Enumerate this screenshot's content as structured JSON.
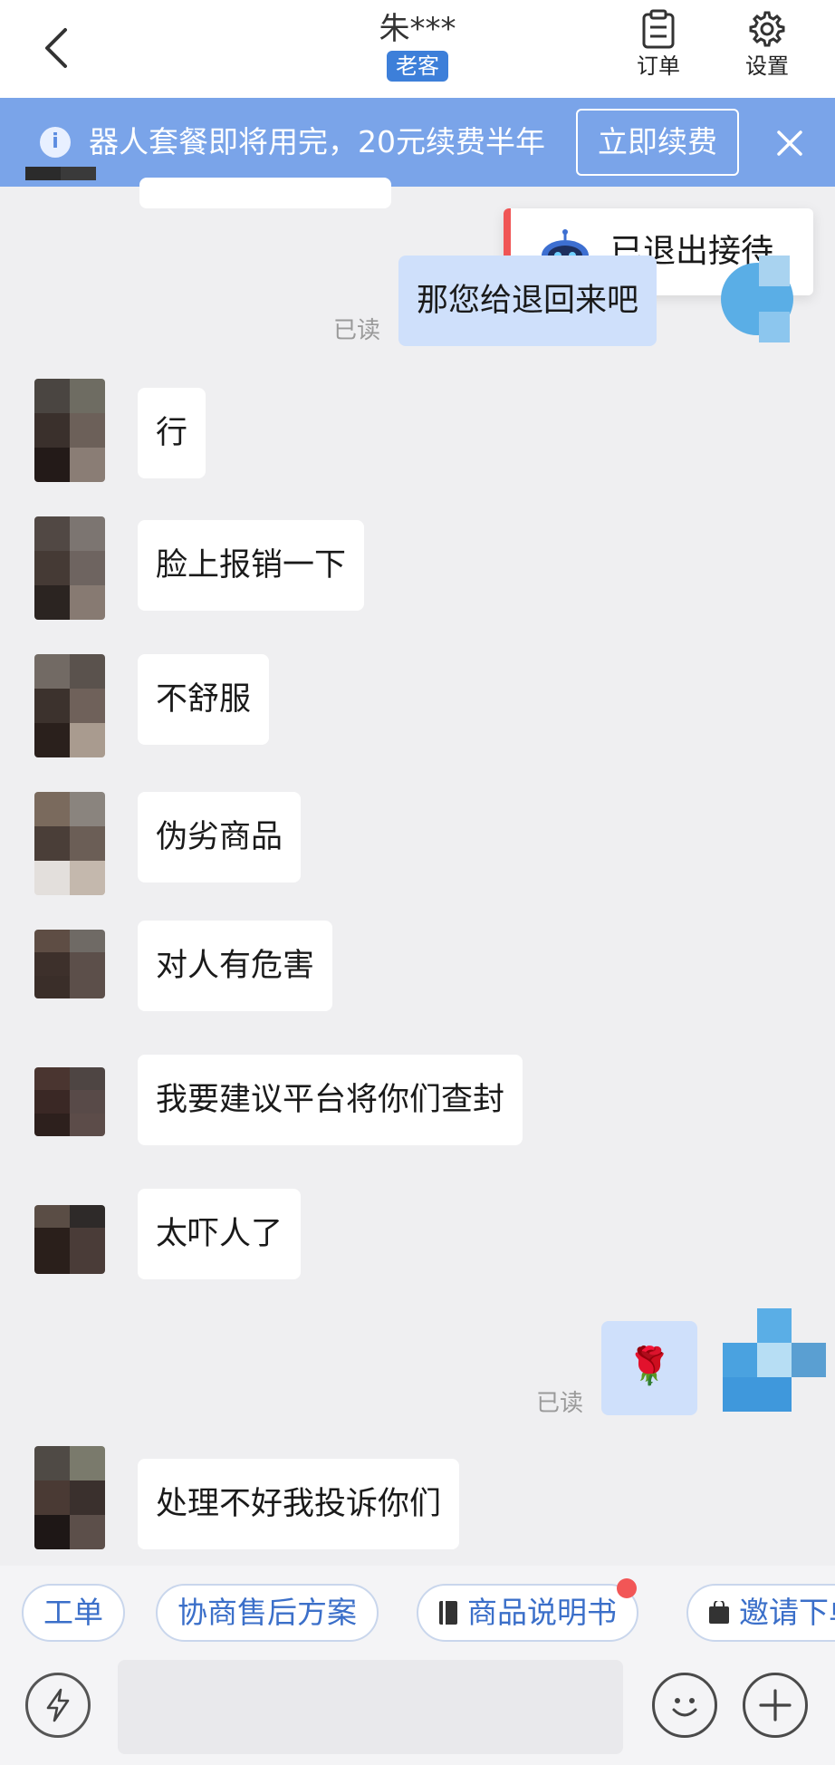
{
  "header": {
    "title": "朱***",
    "tag": "老客",
    "actions": [
      {
        "label": "订单",
        "icon": "clipboard-icon"
      },
      {
        "label": "设置",
        "icon": "gear-icon"
      }
    ]
  },
  "notice": {
    "text": "器人套餐即将用完，20元续费半年",
    "button": "立即续费"
  },
  "toast": {
    "text": "已退出接待"
  },
  "messages": {
    "self_1": "那您给退回来吧",
    "read_1": "已读",
    "m1": "行",
    "m2": "脸上报销一下",
    "m3": "不舒服",
    "m4": "伪劣商品",
    "m5": "对人有危害",
    "m6": "我要建议平台将你们查封",
    "m7": "太吓人了",
    "self_rose": "🌹",
    "read_2": "已读",
    "m8": "处理不好我投诉你们"
  },
  "quick_replies": [
    "工单",
    "协商售后方案",
    "商品说明书",
    "邀请下单"
  ],
  "colors": {
    "accent": "#3d7fd9",
    "notice_bg": "#7aa4e9",
    "self_bubble": "#cfe0fb",
    "chip_text": "#3b6fc9",
    "badge": "#f25656"
  }
}
